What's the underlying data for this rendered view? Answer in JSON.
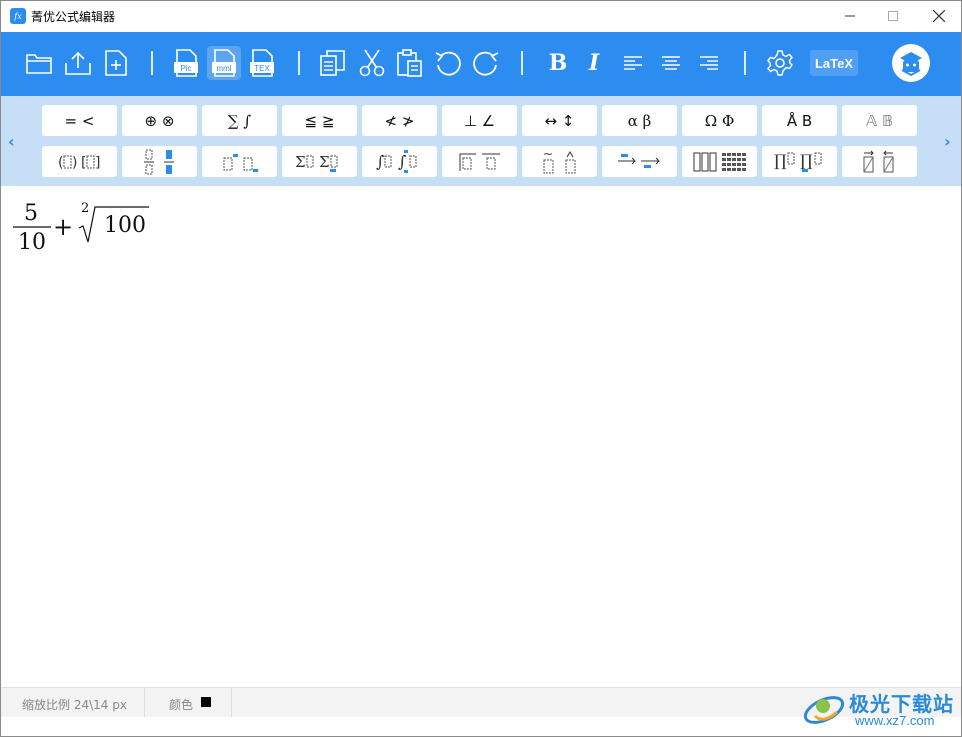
{
  "app": {
    "title": "菁优公式编辑器",
    "icon_text": "fx"
  },
  "window_controls": {
    "minimize": "—",
    "maximize": "☐",
    "close": "✕"
  },
  "toolbar": {
    "accent": "#2d8cf0",
    "items": [
      {
        "name": "open-folder-icon"
      },
      {
        "name": "export-icon"
      },
      {
        "name": "new-file-icon"
      },
      {
        "name": "save-pic-icon",
        "label": "Pic"
      },
      {
        "name": "save-mml-icon",
        "label": "mml"
      },
      {
        "name": "save-tex-icon",
        "label": "TEX"
      },
      {
        "name": "copy-icon"
      },
      {
        "name": "cut-icon"
      },
      {
        "name": "paste-icon"
      },
      {
        "name": "undo-icon"
      },
      {
        "name": "redo-icon"
      },
      {
        "name": "bold-icon",
        "label": "B"
      },
      {
        "name": "italic-icon",
        "label": "I"
      },
      {
        "name": "align-left-icon"
      },
      {
        "name": "align-center-icon"
      },
      {
        "name": "align-right-icon"
      },
      {
        "name": "settings-icon"
      }
    ],
    "latex_label": "LaTeX"
  },
  "palette": {
    "row1": [
      "= <",
      "⊕ ⊗",
      "∑ ∫",
      "≦ ≧",
      "≮ ≯",
      "⊥ ∠",
      "↔ ↕",
      "α β",
      "Ω Φ",
      "Å B",
      "𝔸 𝔹"
    ],
    "row2": [
      "(⬚) [⬚]",
      "⬚/⬚",
      "⬚▪ ⬚▪",
      "∑⬚ ∑⬚",
      "∫⬚ ∫⬚",
      "⎴⬚ ⬚",
      "~⬚ ^⬚",
      "→ →",
      "▥ ▦",
      "∏⬚ ∏⬚",
      "⬚⃗ ⬚⃖"
    ]
  },
  "equation": {
    "numerator": "5",
    "denominator": "10",
    "operator": "+",
    "root_index": "2",
    "radicand": "100"
  },
  "status": {
    "zoom_label": "缩放比例 24\\14 px",
    "color_label": "颜色",
    "color_value": "#000000"
  },
  "watermark": {
    "text": "极光下载站",
    "url": "www.xz7.com"
  }
}
